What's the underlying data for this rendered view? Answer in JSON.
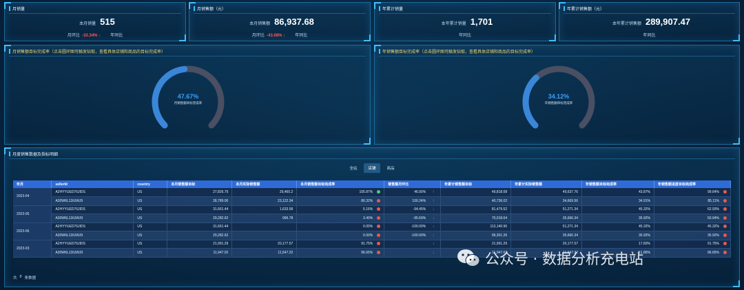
{
  "kpis": [
    {
      "title": "月销量",
      "label": "本月销量",
      "value": "515",
      "sub1_label": "月环比",
      "sub1_value": "-32.34%",
      "sub1_arrow": "↓",
      "sub2_label": "年同比"
    },
    {
      "title": "月销售额（元）",
      "label": "本月销售额",
      "value": "86,937.68",
      "sub1_label": "月环比",
      "sub1_value": "-43.08%",
      "sub1_arrow": "↓",
      "sub2_label": "年同比"
    },
    {
      "title": "年累计销量",
      "label": "本年累计销量",
      "value": "1,701",
      "sub2_label": "年同比"
    },
    {
      "title": "年累计销售额（元）",
      "label": "本年累计销售额",
      "value": "289,907.47",
      "sub2_label": "年同比"
    }
  ],
  "gauges": [
    {
      "title": "月销售额目标完成率（点击圆环图可触发钻取，查看具体店铺和商品的目标完成率）",
      "value_text": "47.67%",
      "value": 0.4767,
      "label": "月销售额目标完成率"
    },
    {
      "title": "年销售额目标完成率（点击圆环图可触发钻取，查看具体店铺和商品的目标完成率）",
      "value_text": "34.12%",
      "value": 0.3412,
      "label": "年销售额目标完成率"
    }
  ],
  "table_panel": {
    "title": "月度销售数据及指标明细",
    "tabs": [
      "全站",
      "店铺",
      "商品"
    ],
    "active_tab": 1,
    "columns": [
      "年月",
      "sellerId",
      "country",
      "本月销售额目标",
      "本月实际销售额",
      "本月销售额目标完成率",
      "销售额月环比",
      "年累计销售额目标",
      "年累计实际销售额",
      "年销售额目标完成率",
      "年销售额进度目标完成率"
    ],
    "groups": [
      {
        "month": "2023-04",
        "rows": [
          {
            "seller": "A2HYYUED76JIDS",
            "country": "US",
            "m_target": "27,826.79",
            "m_actual": "29,460.2",
            "m_rate": "105.87%",
            "m_dot": "green",
            "mom": "46.00%",
            "mom_arrow": "up",
            "y_target": "49,818.08",
            "y_actual": "49,637.76",
            "y_rate": "43.87%",
            "y_prog": "99.64%",
            "y_dot": "red"
          },
          {
            "seller": "A30W6L13IUWJ9",
            "country": "US",
            "m_target": "28,789.00",
            "m_actual": "23,122.34",
            "m_rate": "80.32%",
            "m_dot": "red",
            "mom": "100.24%",
            "mom_arrow": "up",
            "y_target": "40,736.02",
            "y_actual": "34,669.56",
            "y_rate": "34.91%",
            "y_prog": "85.11%",
            "y_dot": "red"
          }
        ]
      },
      {
        "month": "2023-05",
        "rows": [
          {
            "seller": "A2HYYUED76JIDS",
            "country": "US",
            "m_target": "31,661.44",
            "m_actual": "1,633.58",
            "m_rate": "5.16%",
            "m_dot": "red",
            "mom": "-94.45%",
            "mom_arrow": "down",
            "y_target": "81,479.52",
            "y_actual": "51,271.34",
            "y_rate": "45.32%",
            "y_prog": "62.93%",
            "y_dot": "red"
          },
          {
            "seller": "A30W6L13IUWJ9",
            "country": "US",
            "m_target": "29,282.62",
            "m_actual": "996.78",
            "m_rate": "3.40%",
            "m_dot": "red",
            "mom": "-95.69%",
            "mom_arrow": "down",
            "y_target": "70,018.64",
            "y_actual": "35,666.34",
            "y_rate": "35.92%",
            "y_prog": "50.94%",
            "y_dot": "red"
          }
        ]
      },
      {
        "month": "2023-06",
        "rows": [
          {
            "seller": "A2HYYUED76JIDS",
            "country": "US",
            "m_target": "31,661.44",
            "m_actual": "",
            "m_rate": "0.00%",
            "m_dot": "red",
            "mom": "-100.00%",
            "mom_arrow": "down",
            "y_target": "113,140.96",
            "y_actual": "51,271.34",
            "y_rate": "45.32%",
            "y_prog": "45.32%",
            "y_dot": "red"
          },
          {
            "seller": "A30W6L13IUWJ9",
            "country": "US",
            "m_target": "29,282.62",
            "m_actual": "",
            "m_rate": "0.00%",
            "m_dot": "red",
            "mom": "-100.00%",
            "mom_arrow": "down",
            "y_target": "99,301.26",
            "y_actual": "35,666.34",
            "y_rate": "35.92%",
            "y_prog": "35.92%",
            "y_dot": "red"
          }
        ]
      },
      {
        "month": "2023-03",
        "rows": [
          {
            "seller": "A2HYYUED76JIDS",
            "country": "US",
            "m_target": "21,991.29",
            "m_actual": "20,177.57",
            "m_rate": "91.75%",
            "m_dot": "red",
            "mom": "",
            "mom_arrow": "down",
            "y_target": "21,991.29",
            "y_actual": "20,177.57",
            "y_rate": "17.83%",
            "y_prog": "91.75%",
            "y_dot": "red"
          },
          {
            "seller": "A30W6L13IUWJ9",
            "country": "US",
            "m_target": "11,947.02",
            "m_actual": "11,547.22",
            "m_rate": "96.65%",
            "m_dot": "red",
            "mom": "",
            "mom_arrow": "down",
            "y_target": "11,947.02",
            "y_actual": "11,547.22",
            "y_rate": "11.86%",
            "y_prog": "96.65%",
            "y_dot": "red"
          }
        ]
      }
    ],
    "footer": {
      "prefix": "共",
      "count": "8",
      "suffix": "条数据"
    }
  },
  "watermark": "公众号 · 数据分析充电站",
  "colors": {
    "accent": "#3fc0ff",
    "header_blue": "#2f6bd8",
    "negative": "#ff5a55",
    "positive": "#4fcf6d",
    "gauge_fill": "#3a86d8",
    "gauge_track": "#4a4f63"
  }
}
